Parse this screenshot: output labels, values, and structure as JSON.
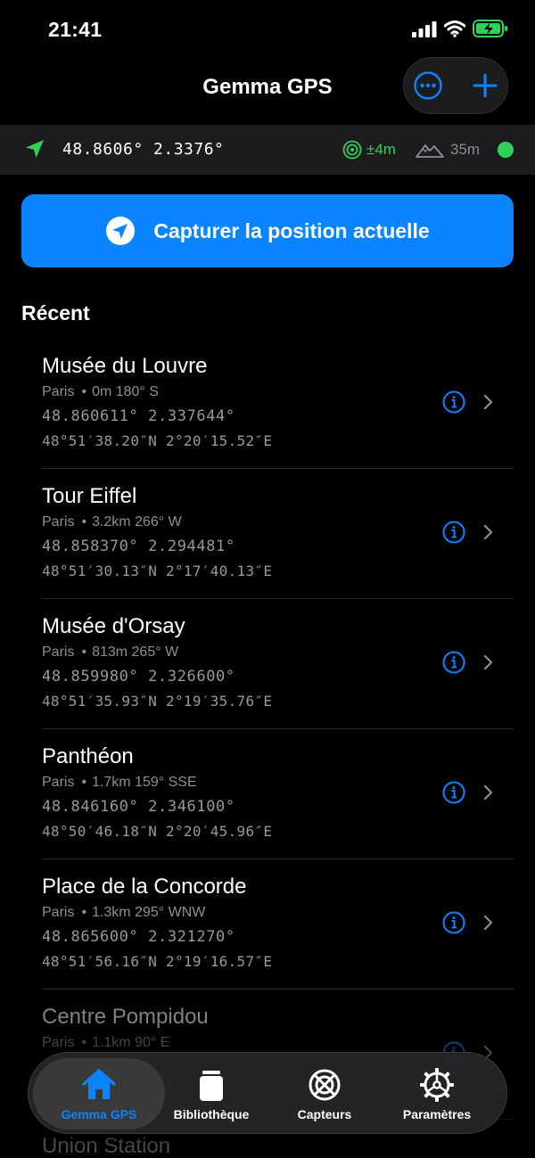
{
  "status_bar": {
    "time": "21:41"
  },
  "header": {
    "title": "Gemma GPS"
  },
  "current_location": {
    "coordinates": "48.8606° 2.3376°",
    "accuracy": "±4m",
    "altitude": "35m"
  },
  "capture_button": {
    "label": "Capturer la position actuelle"
  },
  "section": {
    "title": "Récent"
  },
  "places": [
    {
      "name": "Musée du Louvre",
      "city": "Paris",
      "detail": "0m 180° S",
      "decimal": "48.860611°  2.337644°",
      "dms": "48°51′38.20″N 2°20′15.52″E"
    },
    {
      "name": "Tour Eiffel",
      "city": "Paris",
      "detail": "3.2km 266° W",
      "decimal": "48.858370°  2.294481°",
      "dms": "48°51′30.13″N 2°17′40.13″E"
    },
    {
      "name": "Musée d'Orsay",
      "city": "Paris",
      "detail": "813m 265° W",
      "decimal": "48.859980°  2.326600°",
      "dms": "48°51′35.93″N 2°19′35.76″E"
    },
    {
      "name": "Panthéon",
      "city": "Paris",
      "detail": "1.7km 159° SSE",
      "decimal": "48.846160°  2.346100°",
      "dms": "48°50′46.18″N 2°20′45.96″E"
    },
    {
      "name": "Place de la Concorde",
      "city": "Paris",
      "detail": "1.3km 295° WNW",
      "decimal": "48.865600°  2.321270°",
      "dms": "48°51′56.16″N 2°19′16.57″E"
    },
    {
      "name": "Centre Pompidou",
      "city": "Paris",
      "detail": "1.1km 90° E",
      "decimal": "",
      "dms": ""
    }
  ],
  "partial_place": {
    "name": "Union Station"
  },
  "tabs": [
    {
      "label": "Gemma GPS",
      "icon": "house-icon"
    },
    {
      "label": "Bibliothèque",
      "icon": "jar-icon"
    },
    {
      "label": "Capteurs",
      "icon": "crosshair-icon"
    },
    {
      "label": "Paramètres",
      "icon": "gear-icon"
    }
  ],
  "colors": {
    "accent": "#0a84ff",
    "success": "#30d158",
    "secondary_text": "#8e8e93",
    "surface": "#1c1c1e"
  }
}
